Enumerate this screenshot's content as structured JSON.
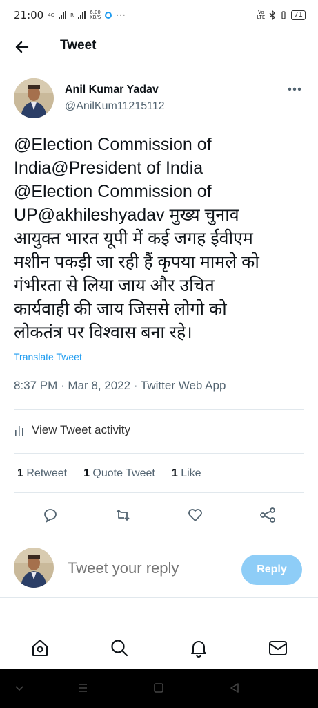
{
  "status_bar": {
    "time": "21:00",
    "net_4g": "4G",
    "net_r": "R",
    "speed_value": "6.00",
    "speed_unit": "KB/S",
    "more": "···",
    "volte_top": "Vo",
    "volte_bottom": "LTE",
    "battery": "71"
  },
  "header": {
    "title": "Tweet"
  },
  "tweet": {
    "author_name": "Anil Kumar Yadav",
    "author_handle": "@AnilKum11215112",
    "text": "@Election Commission of\nIndia@President of India\n@Election Commission of\nUP@akhileshyadav मुख्य चुनाव\nआयुक्त भारत यूपी में कई जगह ईवीएम\nमशीन पकड़ी जा रही हैं कृपया मामले को\nगंभीरता से लिया जाय और उचित\nकार्यवाही की जाय जिससे लोगो को\nलोकतंत्र पर विश्वास बना रहे।",
    "translate_label": "Translate Tweet",
    "timestamp": "8:37 PM · Mar 8, 2022 · Twitter Web App",
    "activity_label": "View Tweet activity",
    "retweets_count": "1",
    "retweets_label": "Retweet",
    "quotes_count": "1",
    "quotes_label": "Quote Tweet",
    "likes_count": "1",
    "likes_label": "Like"
  },
  "reply": {
    "placeholder": "Tweet your reply",
    "button_label": "Reply"
  },
  "colors": {
    "accent": "#1d9bf0",
    "reply_button_disabled": "#8ecdf7",
    "text_secondary": "#536471"
  },
  "icons": {
    "back": "arrow-left-icon",
    "more": "more-horizontal-icon",
    "activity": "bar-chart-icon",
    "reply": "comment-icon",
    "retweet": "retweet-icon",
    "like": "heart-icon",
    "share": "share-icon",
    "tabs": [
      "home-icon",
      "search-icon",
      "bell-icon",
      "mail-icon"
    ],
    "system_nav": [
      "chevron-down-icon",
      "menu-icon",
      "square-icon",
      "triangle-back-icon"
    ]
  }
}
